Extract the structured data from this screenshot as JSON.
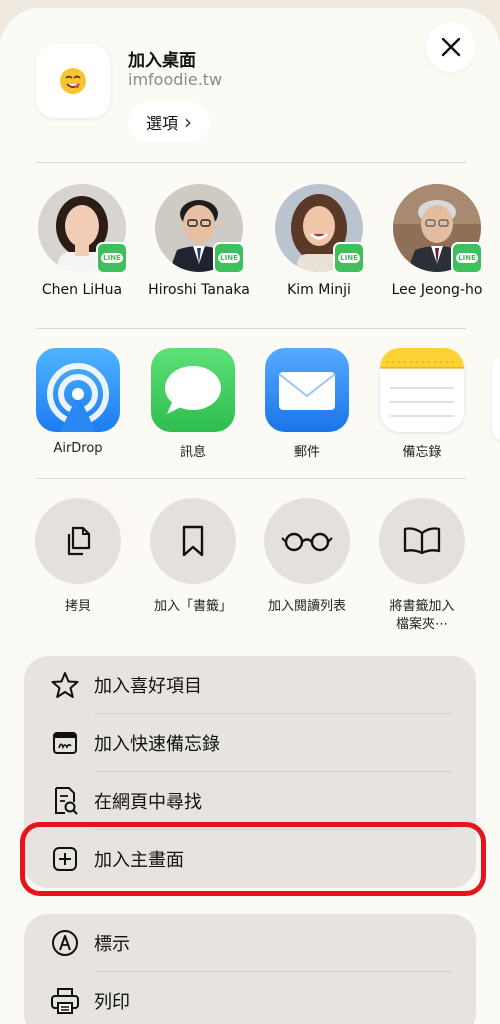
{
  "header": {
    "title": "加入桌面",
    "subtitle": "imfoodie.tw",
    "options_label": "選項",
    "options_chevron": "›"
  },
  "contacts": [
    {
      "name": "Chen LiHua",
      "badge": "LINE"
    },
    {
      "name": "Hiroshi Tanaka",
      "badge": "LINE"
    },
    {
      "name": "Kim Minji",
      "badge": "LINE"
    },
    {
      "name": "Lee Jeong-ho",
      "badge": "LINE"
    }
  ],
  "apps": [
    {
      "label": "AirDrop",
      "icon": "airdrop-icon"
    },
    {
      "label": "訊息",
      "icon": "messages-icon"
    },
    {
      "label": "郵件",
      "icon": "mail-icon"
    },
    {
      "label": "備忘錄",
      "icon": "notes-icon"
    }
  ],
  "actions": [
    {
      "label": "拷貝",
      "icon": "copy-icon"
    },
    {
      "label": "加入「書籤」",
      "icon": "bookmark-icon"
    },
    {
      "label": "加入閱讀列表",
      "icon": "glasses-icon"
    },
    {
      "label": "將書籤加入",
      "label2": "檔案夾⋯",
      "icon": "open-book-icon"
    }
  ],
  "menu1": [
    {
      "label": "加入喜好項目",
      "icon": "star-icon"
    },
    {
      "label": "加入快速備忘錄",
      "icon": "quick-note-icon"
    },
    {
      "label": "在網頁中尋找",
      "icon": "find-in-page-icon"
    },
    {
      "label": "加入主畫面",
      "icon": "plus-square-icon"
    }
  ],
  "menu2": [
    {
      "label": "標示",
      "icon": "markup-icon"
    },
    {
      "label": "列印",
      "icon": "printer-icon"
    }
  ],
  "colors": {
    "highlight": "#e6141a",
    "line_green": "#3ec15d",
    "messages_green": "#34c759",
    "mail_blue": "#1e84f5"
  }
}
